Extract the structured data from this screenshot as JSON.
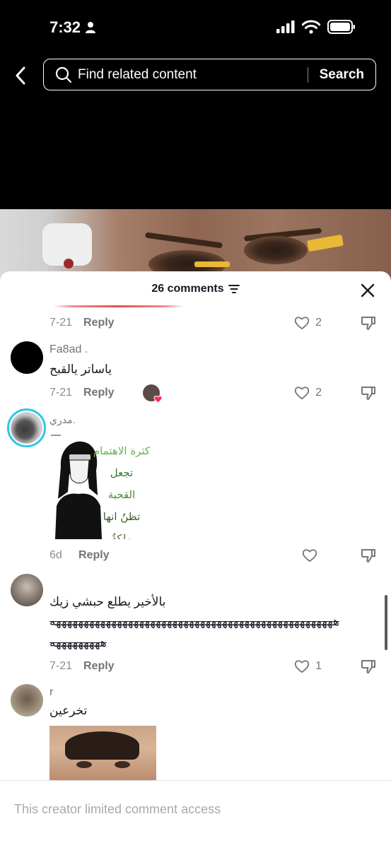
{
  "status_bar": {
    "time": "7:32"
  },
  "search": {
    "placeholder": "Find related content",
    "button_label": "Search"
  },
  "comments_header": {
    "title": "26 comments"
  },
  "comments": [
    {
      "date": "7-21",
      "reply_label": "Reply",
      "likes": "2"
    },
    {
      "username": "Fa8ad .",
      "text": "ياساتر يالقبح",
      "date": "7-21",
      "reply_label": "Reply",
      "likes": "2"
    },
    {
      "username": "مدري.",
      "sticker_lines": [
        "كثرة الاهتمام",
        "تجعل",
        "القحبة",
        "تظنُ انها",
        "ملِكةٌ"
      ],
      "date": "6d",
      "reply_label": "Reply",
      "likes": ""
    },
    {
      "text_line1": "بالأخير يطلع حبشي زيك",
      "text_line2": "هههههههههههههههههههههههههههههههههههههههههههههههههههه",
      "text_line3": "هههههههههه",
      "date": "7-21",
      "reply_label": "Reply",
      "likes": "1"
    },
    {
      "username": "r",
      "text": "تخرعين"
    }
  ],
  "footer": {
    "notice": "This creator limited comment access"
  },
  "colors": {
    "accent_red": "#fe2c55",
    "text_primary": "#161823",
    "text_secondary": "#8a8b91"
  }
}
